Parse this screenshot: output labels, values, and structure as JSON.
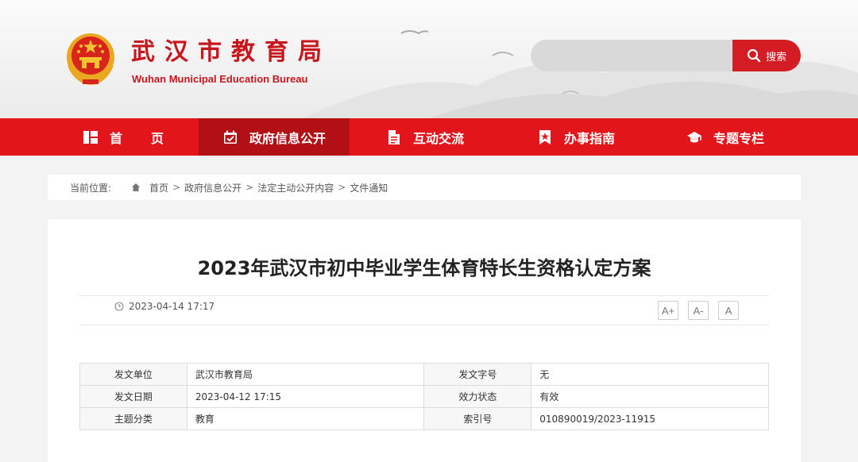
{
  "header": {
    "title": "武汉市教育局",
    "subtitle": "Wuhan Municipal Education Bureau",
    "search": {
      "placeholder": "",
      "button_label": "搜索"
    }
  },
  "nav": {
    "items": [
      {
        "label": "首页",
        "icon": "grid-icon"
      },
      {
        "label": "政府信息公开",
        "icon": "calendar-check-icon",
        "active": true
      },
      {
        "label": "互动交流",
        "icon": "document-icon"
      },
      {
        "label": "办事指南",
        "icon": "bookmark-star-icon"
      },
      {
        "label": "专题专栏",
        "icon": "graduation-cap-icon"
      }
    ]
  },
  "breadcrumb": {
    "label": "当前位置:",
    "items": [
      "首页",
      "政府信息公开",
      "法定主动公开内容",
      "文件通知"
    ]
  },
  "article": {
    "title": "2023年武汉市初中毕业学生体育特长生资格认定方案",
    "date": "2023-04-14 17:17",
    "font_sizes": [
      "A+",
      "A-",
      "A"
    ]
  },
  "info_table": {
    "rows": [
      {
        "k1": "发文单位",
        "v1": "武汉市教育局",
        "k2": "发文字号",
        "v2": "无"
      },
      {
        "k1": "发文日期",
        "v1": "2023-04-12 17:15",
        "k2": "效力状态",
        "v2": "有效"
      },
      {
        "k1": "主题分类",
        "v1": "教育",
        "k2": "索引号",
        "v2": "010890019/2023-11915"
      }
    ]
  },
  "colors": {
    "brand_red": "#e2151b",
    "nav_active": "#b21015",
    "search_button": "#d41c24"
  }
}
